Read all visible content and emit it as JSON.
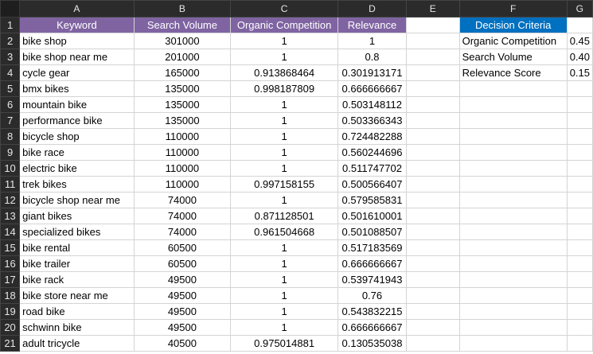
{
  "columns": [
    "A",
    "B",
    "C",
    "D",
    "E",
    "F",
    "G"
  ],
  "headers": {
    "keyword": "Keyword",
    "search_volume": "Search Volume",
    "organic_competition": "Organic Competition",
    "relevance": "Relevance",
    "decision_criteria": "Decision Criteria"
  },
  "rows": [
    {
      "n": "2",
      "keyword": "bike shop",
      "volume": "301000",
      "competition": "1",
      "relevance": "1"
    },
    {
      "n": "3",
      "keyword": "bike shop near me",
      "volume": "201000",
      "competition": "1",
      "relevance": "0.8"
    },
    {
      "n": "4",
      "keyword": "cycle gear",
      "volume": "165000",
      "competition": "0.913868464",
      "relevance": "0.301913171"
    },
    {
      "n": "5",
      "keyword": "bmx bikes",
      "volume": "135000",
      "competition": "0.998187809",
      "relevance": "0.666666667"
    },
    {
      "n": "6",
      "keyword": "mountain bike",
      "volume": "135000",
      "competition": "1",
      "relevance": "0.503148112"
    },
    {
      "n": "7",
      "keyword": "performance bike",
      "volume": "135000",
      "competition": "1",
      "relevance": "0.503366343"
    },
    {
      "n": "8",
      "keyword": "bicycle shop",
      "volume": "110000",
      "competition": "1",
      "relevance": "0.724482288"
    },
    {
      "n": "9",
      "keyword": "bike race",
      "volume": "110000",
      "competition": "1",
      "relevance": "0.560244696"
    },
    {
      "n": "10",
      "keyword": "electric bike",
      "volume": "110000",
      "competition": "1",
      "relevance": "0.511747702"
    },
    {
      "n": "11",
      "keyword": "trek bikes",
      "volume": "110000",
      "competition": "0.997158155",
      "relevance": "0.500566407"
    },
    {
      "n": "12",
      "keyword": "bicycle shop near me",
      "volume": "74000",
      "competition": "1",
      "relevance": "0.579585831"
    },
    {
      "n": "13",
      "keyword": "giant bikes",
      "volume": "74000",
      "competition": "0.871128501",
      "relevance": "0.501610001"
    },
    {
      "n": "14",
      "keyword": "specialized bikes",
      "volume": "74000",
      "competition": "0.961504668",
      "relevance": "0.501088507"
    },
    {
      "n": "15",
      "keyword": "bike rental",
      "volume": "60500",
      "competition": "1",
      "relevance": "0.517183569"
    },
    {
      "n": "16",
      "keyword": "bike trailer",
      "volume": "60500",
      "competition": "1",
      "relevance": "0.666666667"
    },
    {
      "n": "17",
      "keyword": "bike rack",
      "volume": "49500",
      "competition": "1",
      "relevance": "0.539741943"
    },
    {
      "n": "18",
      "keyword": "bike store near me",
      "volume": "49500",
      "competition": "1",
      "relevance": "0.76"
    },
    {
      "n": "19",
      "keyword": "road bike",
      "volume": "49500",
      "competition": "1",
      "relevance": "0.543832215"
    },
    {
      "n": "20",
      "keyword": "schwinn bike",
      "volume": "49500",
      "competition": "1",
      "relevance": "0.666666667"
    },
    {
      "n": "21",
      "keyword": "adult tricycle",
      "volume": "40500",
      "competition": "0.975014881",
      "relevance": "0.130535038"
    }
  ],
  "criteria": [
    {
      "label": "Organic Competition",
      "weight": "0.45"
    },
    {
      "label": "Search Volume",
      "weight": "0.40"
    },
    {
      "label": "Relevance Score",
      "weight": "0.15"
    }
  ],
  "row1_number": "1",
  "colors": {
    "purple_header": "#8064a2",
    "blue_header": "#0070c0",
    "grid": "#d4d4d4",
    "headers_bg": "#2b2b2b"
  }
}
